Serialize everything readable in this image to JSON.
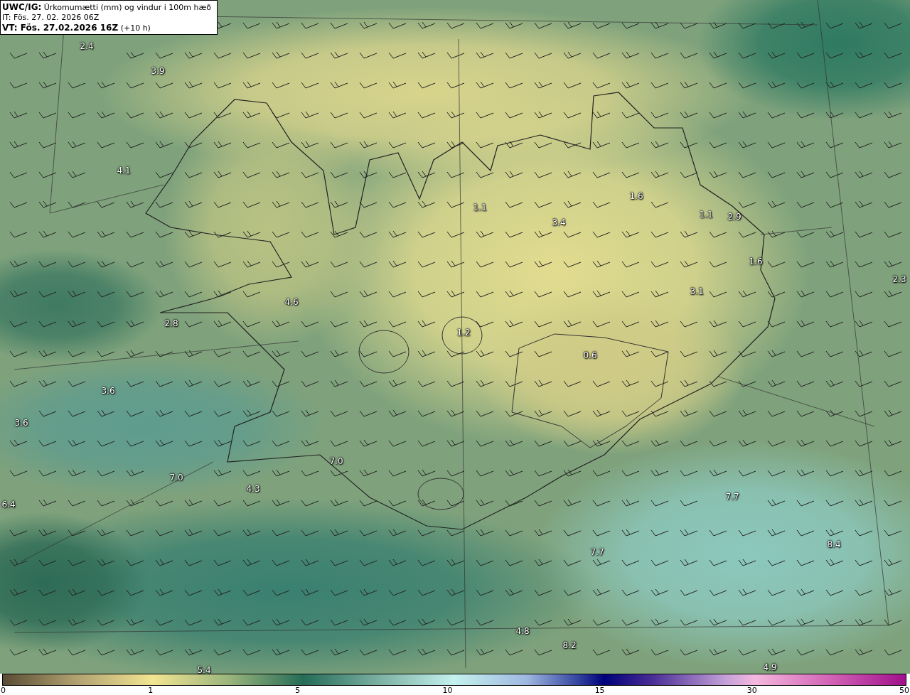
{
  "header": {
    "product": "UWC/IG:",
    "title": "Úrkomumætti (mm) og vindur i 100m hæð",
    "initial_time": "IT: Fös. 27. 02. 2026 06Z",
    "valid_time": "VT: Fös. 27.02.2026 16Z",
    "lead": "(+10 h)"
  },
  "map_labels": [
    "2.4",
    "3.9",
    "4.1",
    "1.1",
    "1.6",
    "3.4",
    "1.1",
    "2.9",
    "1.6",
    "2.3",
    "3.1",
    "4.6",
    "2.8",
    "1.2",
    "0.6",
    "3.6",
    "3.6",
    "7.0",
    "7.0",
    "4.3",
    "6.4",
    "7.7",
    "7.7",
    "8.4",
    "4.8",
    "8.2",
    "5.4",
    "4.9"
  ],
  "colorbar": {
    "ticks": [
      "0",
      "1",
      "5",
      "10",
      "15",
      "30",
      "50"
    ]
  }
}
